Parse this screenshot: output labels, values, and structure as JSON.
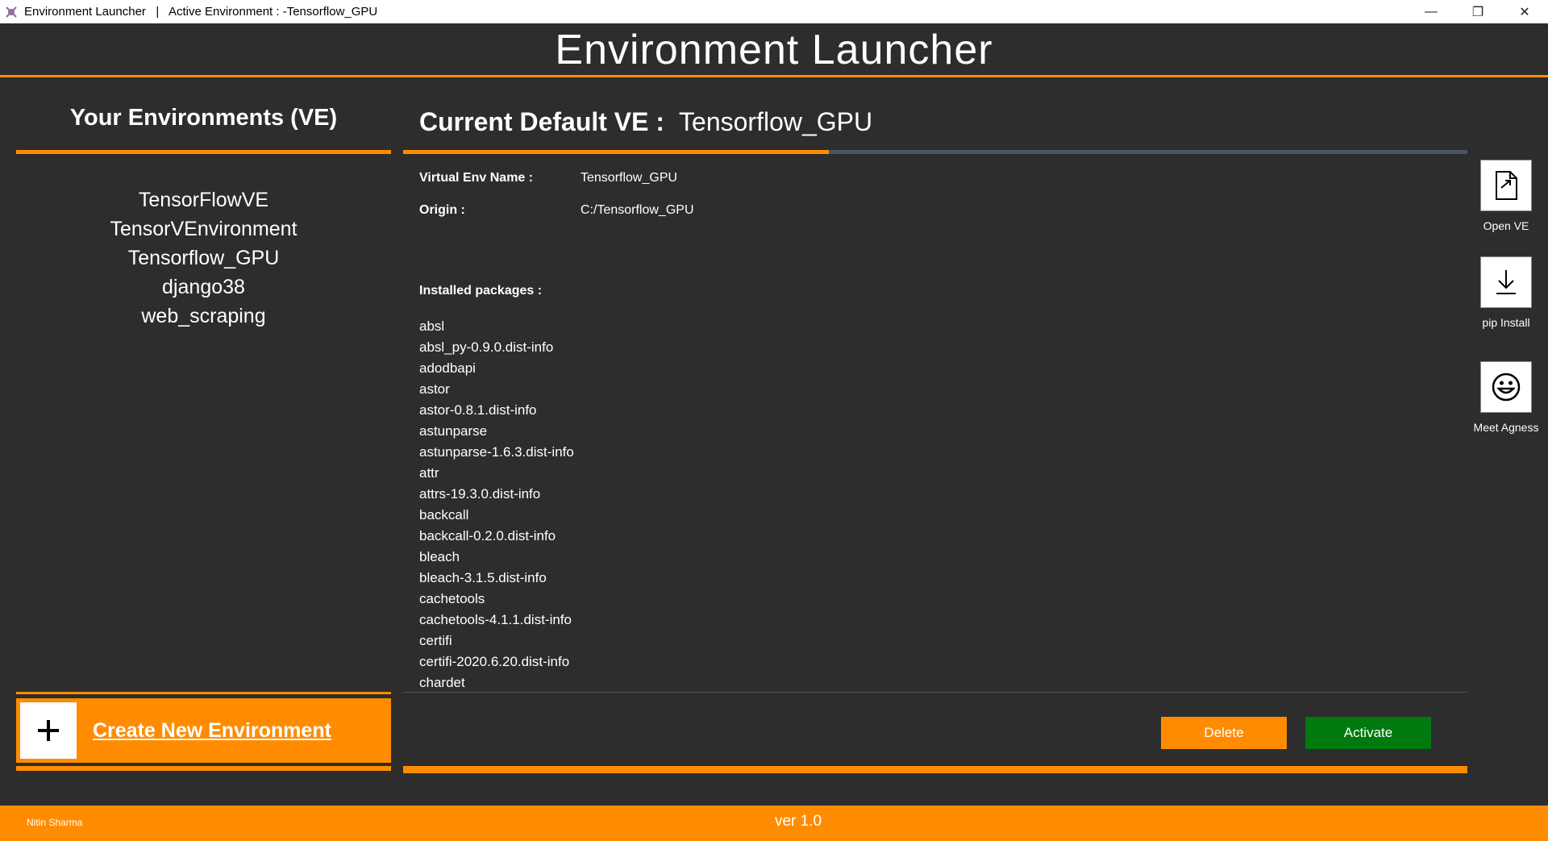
{
  "window": {
    "title": "Environment Launcher   |   Active Environment : -Tensorflow_GPU",
    "minimize_glyph": "—",
    "maximize_glyph": "❐",
    "close_glyph": "✕"
  },
  "header": {
    "title": "Environment Launcher"
  },
  "sidebar": {
    "title": "Your Environments (VE)",
    "environments": [
      {
        "label": "TensorFlowVE"
      },
      {
        "label": "TensorVEnvironment"
      },
      {
        "label": "Tensorflow_GPU"
      },
      {
        "label": "django38"
      },
      {
        "label": "web_scraping"
      }
    ],
    "create_button": {
      "label": "Create New Environment",
      "icon": "plus-icon"
    }
  },
  "main": {
    "current_label": "Current Default VE :",
    "current_value": "Tensorflow_GPU",
    "progress": 0.4,
    "env_name_label": "Virtual Env Name :",
    "env_name_value": "Tensorflow_GPU",
    "origin_label": "Origin :",
    "origin_value": "C:/Tensorflow_GPU",
    "packages_label": "Installed packages :",
    "packages": [
      "absl",
      "absl_py-0.9.0.dist-info",
      "adodbapi",
      "astor",
      "astor-0.8.1.dist-info",
      "astunparse",
      "astunparse-1.6.3.dist-info",
      "attr",
      "attrs-19.3.0.dist-info",
      "backcall",
      "backcall-0.2.0.dist-info",
      "bleach",
      "bleach-3.1.5.dist-info",
      "cachetools",
      "cachetools-4.1.1.dist-info",
      "certifi",
      "certifi-2020.6.20.dist-info",
      "chardet"
    ],
    "delete_label": "Delete",
    "activate_label": "Activate"
  },
  "tools": {
    "open_ve": {
      "label": "Open VE",
      "icon": "open-file-icon"
    },
    "pip_install": {
      "label": "pip Install",
      "icon": "download-icon"
    },
    "meet_agness": {
      "label": "Meet Agness",
      "icon": "smiley-icon"
    }
  },
  "footer": {
    "author": "Nitin Sharma",
    "version": "ver 1.0"
  },
  "colors": {
    "accent": "#ff8c00",
    "background": "#2d2d2d",
    "activate": "#007a0f",
    "track": "#4a5468"
  }
}
